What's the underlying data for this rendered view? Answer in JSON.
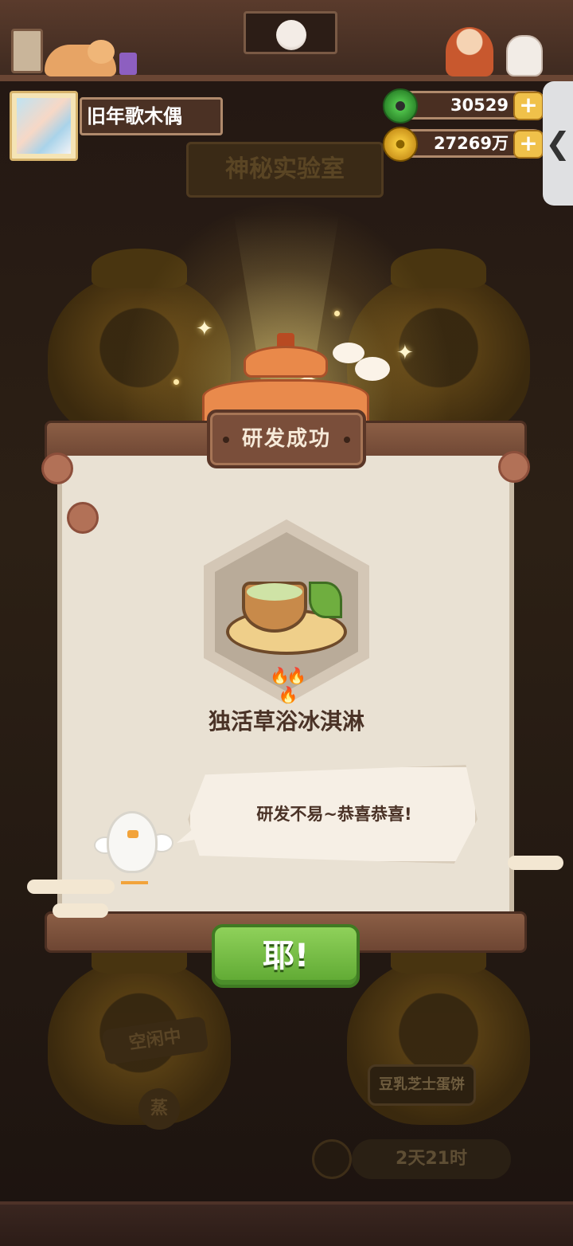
{
  "player": {
    "name": "旧年歌木偶"
  },
  "location": {
    "title": "神秘实验室"
  },
  "currency": {
    "jade": "30529",
    "coins": "27269万",
    "plus": "+"
  },
  "side_tab": {
    "label": "❮"
  },
  "modal": {
    "title": "研发成功",
    "dish_name": "独活草浴冰淇淋",
    "heat_icons": "🔥🔥🔥",
    "message": "研发不易~恭喜恭喜!",
    "confirm_label": "耶!"
  },
  "background": {
    "idle_label": "空闲中",
    "steam_label": "蒸",
    "cooking_dish": "豆乳芝士蛋饼",
    "timer": "2天21时"
  },
  "colors": {
    "accent_green": "#5ea832",
    "wood": "#7a4e3a",
    "paper": "#e9e1d3",
    "gold": "#f0c14a"
  }
}
